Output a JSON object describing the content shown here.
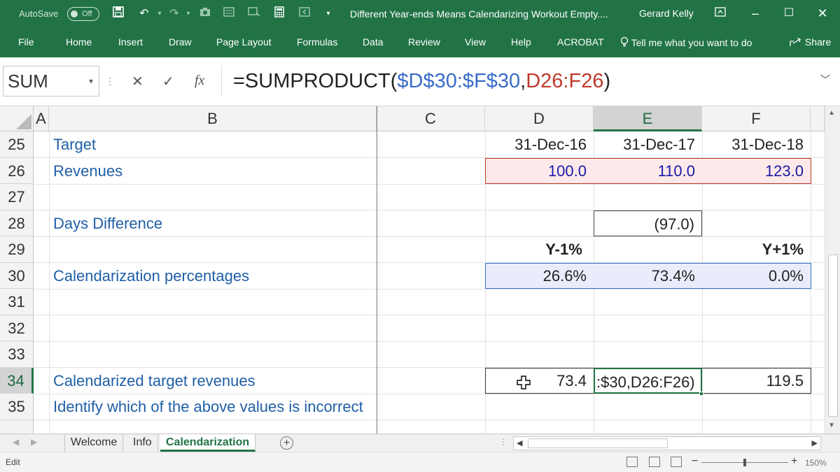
{
  "titlebar": {
    "autosave_label": "AutoSave",
    "autosave_state": "Off",
    "document_title": "Different Year-ends Means Calendarizing Workout Empty....",
    "user": "Gerard Kelly"
  },
  "ribbon": {
    "tabs": [
      "File",
      "Home",
      "Insert",
      "Draw",
      "Page Layout",
      "Formulas",
      "Data",
      "Review",
      "View",
      "Help",
      "ACROBAT"
    ],
    "tell_me": "Tell me what you want to do",
    "share": "Share"
  },
  "formula_bar": {
    "name_box": "SUM",
    "fx": "fx",
    "formula_prefix": "=SUMPRODUCT(",
    "formula_ref1": "$D$30:$F$30",
    "formula_comma": ",",
    "formula_ref2": "D26:F26",
    "formula_suffix": ")"
  },
  "grid": {
    "columns": [
      "A",
      "B",
      "C",
      "D",
      "E",
      "F"
    ],
    "selected_column": "E",
    "rows": [
      "25",
      "26",
      "27",
      "28",
      "29",
      "30",
      "31",
      "32",
      "33",
      "34",
      "35"
    ],
    "selected_row": "34",
    "cells": {
      "B25": "Target",
      "D25": "31-Dec-16",
      "E25": "31-Dec-17",
      "F25": "31-Dec-18",
      "B26": "Revenues",
      "D26": "100.0",
      "E26": "110.0",
      "F26": "123.0",
      "B28": "Days Difference",
      "E28": "(97.0)",
      "D29": "Y-1%",
      "F29": "Y+1%",
      "B30": "Calendarization percentages",
      "D30": "26.6%",
      "E30": "73.4%",
      "F30": "0.0%",
      "B34": "Calendarized target revenues",
      "D34": "73.4",
      "E34": ":$30,D26:F26)",
      "F34": "119.5",
      "B35": "Identify which of the above values is incorrect"
    }
  },
  "sheet_tabs": {
    "tabs": [
      "Welcome",
      "Info",
      "Calendarization"
    ],
    "active": "Calendarization"
  },
  "status_bar": {
    "mode": "Edit",
    "zoom": "150%"
  },
  "colors": {
    "excel_green": "#217346",
    "label_blue": "#1f5fa6",
    "input_blue": "#1a1aa8",
    "revenue_fill": "#fde9e9",
    "revenue_border": "#c0392b",
    "pct_fill": "#e9edfb",
    "pct_border": "#3a6cc9"
  }
}
